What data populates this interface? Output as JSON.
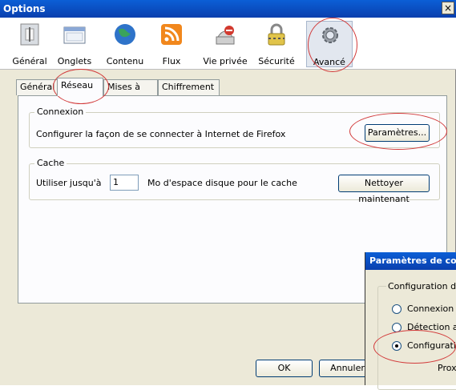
{
  "window": {
    "title": "Options",
    "close": "×"
  },
  "toolbar": {
    "items": [
      {
        "label": "Général"
      },
      {
        "label": "Onglets"
      },
      {
        "label": "Contenu"
      },
      {
        "label": "Flux"
      },
      {
        "label": "Vie privée"
      },
      {
        "label": "Sécurité"
      },
      {
        "label": "Avancé"
      }
    ]
  },
  "tabs": [
    "Général",
    "Réseau",
    "Mises à jour",
    "Chiffrement"
  ],
  "connexion": {
    "legend": "Connexion",
    "text": "Configurer la façon de se connecter à Internet de Firefox",
    "button": "Paramètres..."
  },
  "cache": {
    "legend": "Cache",
    "label_prefix": "Utiliser jusqu'à",
    "value": "1",
    "label_suffix": "Mo d'espace disque pour le cache",
    "button": "Nettoyer maintenant"
  },
  "footer": {
    "ok": "OK",
    "cancel": "Annuler"
  },
  "dialog": {
    "title": "Paramètres de co",
    "group": "Configuration du",
    "options": [
      "Connexion",
      "Détection a",
      "Configurati"
    ],
    "proxy": "Prox"
  },
  "colors": {
    "accent": "#0a3fae",
    "annotation": "#d23a3a"
  }
}
